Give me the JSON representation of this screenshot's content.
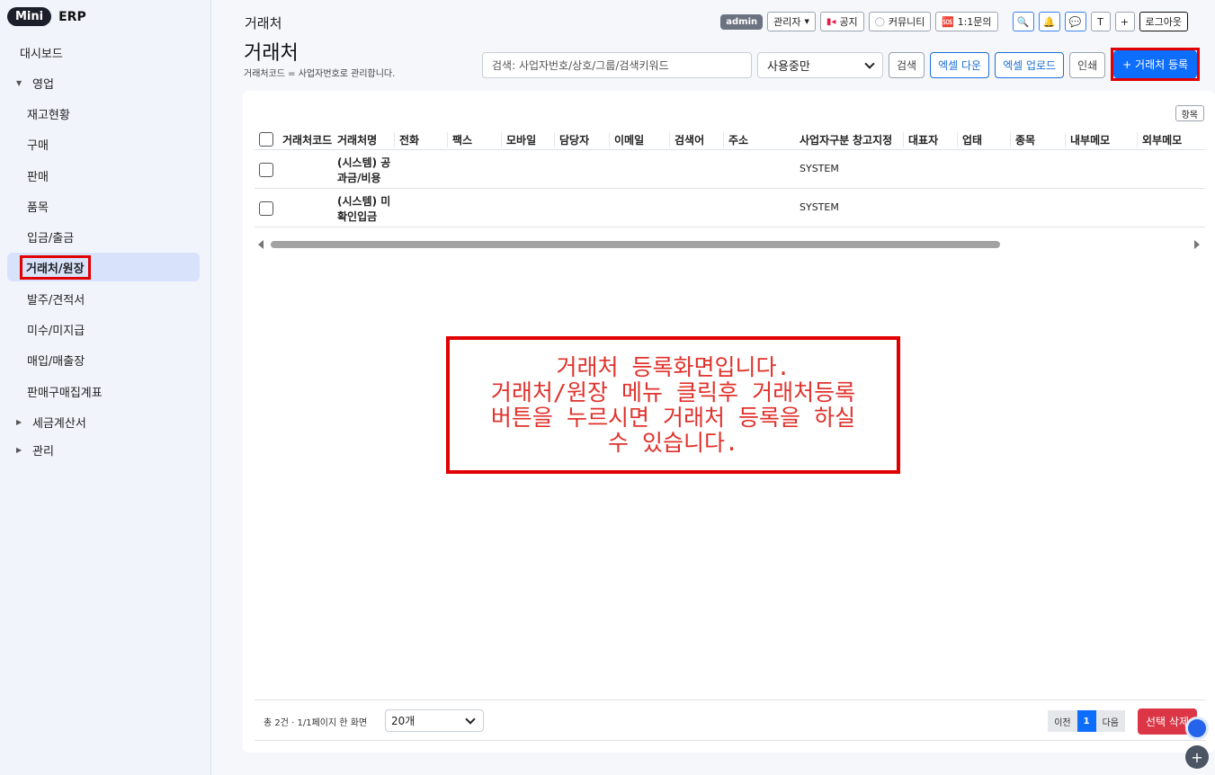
{
  "brand": {
    "mini": "Mini",
    "erp": "ERP"
  },
  "sidebar": {
    "items": [
      {
        "label": "대시보드"
      },
      {
        "label": "영업"
      },
      {
        "label": "재고현황"
      },
      {
        "label": "구매"
      },
      {
        "label": "판매"
      },
      {
        "label": "품목"
      },
      {
        "label": "입금/출금"
      },
      {
        "label": "거래처/원장"
      },
      {
        "label": "발주/견적서"
      },
      {
        "label": "미수/미지급"
      },
      {
        "label": "매입/매출장"
      },
      {
        "label": "판매구매집계표"
      },
      {
        "label": "세금계산서"
      },
      {
        "label": "관리"
      }
    ]
  },
  "topbar": {
    "page_title": "거래처",
    "admin_badge": "admin",
    "role_select": "관리자",
    "notice": "공지",
    "community": "커뮤니티",
    "inquiry": "🆘 1:1문의",
    "search_icon": "🔍",
    "bell_icon": "🔔",
    "chat_icon": "💬",
    "t_button": "T",
    "plus_button": "+",
    "logout": "로그아웃"
  },
  "heading": {
    "title": "거래처",
    "description": "거래처코드 = 사업자번호로 관리합니다."
  },
  "actions": {
    "search_placeholder": "검색: 사업자번호/상호/그룹/검색키워드",
    "status_value": "사용중만",
    "search_btn": "검색",
    "excel_down": "엑셀 다운",
    "excel_up": "엑셀 업로드",
    "print": "인쇄",
    "register": "+ 거래처 등록"
  },
  "table": {
    "columns_btn": "항목",
    "headers": [
      "거래처코드",
      "거래처명",
      "전화",
      "팩스",
      "모바일",
      "담당자",
      "이메일",
      "검색어",
      "주소",
      "사업자구분",
      "창고지정",
      "대표자",
      "업태",
      "종목",
      "내부메모",
      "외부메모"
    ],
    "rows": [
      {
        "name_line1": "(시스템) 공",
        "name_line2": "과금/비용",
        "type": "SYSTEM"
      },
      {
        "name_line1": "(시스템) 미",
        "name_line2": "확인입금",
        "type": "SYSTEM"
      }
    ]
  },
  "note": {
    "lines": [
      "거래처 등록화면입니다.",
      "거래처/원장 메뉴 클릭후 거래처등록",
      "버튼을 누르시면 거래처 등록을 하실",
      "수 있습니다."
    ]
  },
  "footer": {
    "info": "총 2건 · 1/1페이지  한 화면",
    "page_size": "20개",
    "prev": "이전",
    "current": "1",
    "next": "다음",
    "delete": "선택 삭제",
    "fab_plus": "+"
  }
}
